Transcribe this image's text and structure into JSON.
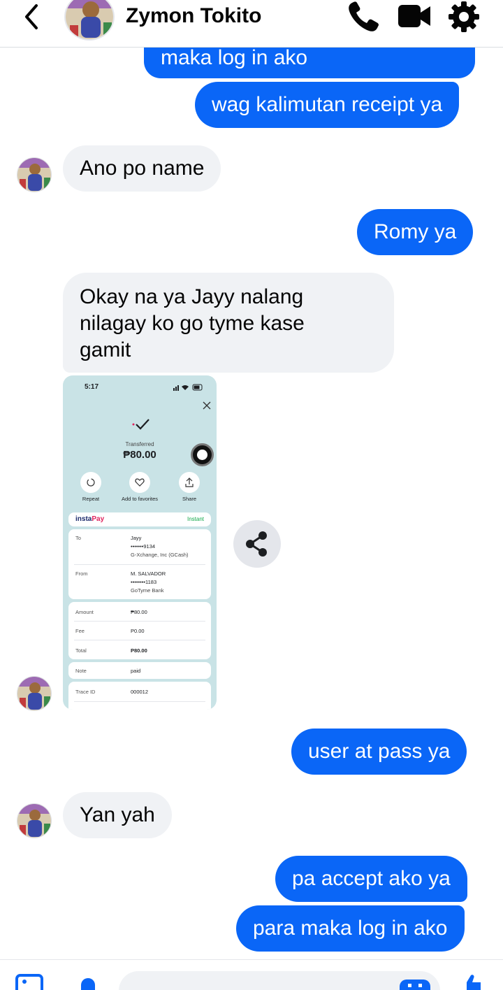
{
  "header": {
    "contact_name": "Zymon Tokito",
    "icons": [
      "back-arrow-icon",
      "phone-icon",
      "video-camera-icon",
      "gear-icon"
    ]
  },
  "messages": [
    {
      "side": "out",
      "text": "maka log in ako"
    },
    {
      "side": "out",
      "text": "wag kalimutan receipt ya"
    },
    {
      "side": "in",
      "text": "Ano po name"
    },
    {
      "side": "out",
      "text": "Romy ya"
    },
    {
      "side": "in",
      "lines": [
        "Okay na ya Jayy nalang",
        "nilagay ko go tyme kase",
        "gamit"
      ]
    },
    {
      "side": "out",
      "text": "user at pass ya"
    },
    {
      "side": "in",
      "text": "Yan yah"
    },
    {
      "side": "out",
      "text": "pa accept ako ya"
    },
    {
      "side": "out",
      "text": "para maka log in ako"
    }
  ],
  "receipt": {
    "time": "5:17",
    "battery": "6",
    "status": "Transferred",
    "amount": "₱80.00",
    "actions": [
      "Repeat",
      "Add to favorites",
      "Share"
    ],
    "brand_prefix": "insta",
    "brand_suffix": "Pay",
    "mode": "Instant",
    "to_label": "To",
    "to_name": "Jayy",
    "to_account": "•••••••9134",
    "to_bank": "G-Xchange, Inc (GCash)",
    "from_label": "From",
    "from_name": "M. SALVADOR",
    "from_account": "••••••••1183",
    "from_bank": "GoTyme Bank",
    "amount_label": "Amount",
    "amount_value": "₱80.00",
    "fee_label": "Fee",
    "fee_value": "P0.00",
    "total_label": "Total",
    "total_value": "P80.00",
    "note_label": "Note",
    "note_value": "paid",
    "trace_label": "Trace ID",
    "trace_value": "000012"
  },
  "composer": {
    "placeholder": "",
    "icons": [
      "image-icon",
      "microphone-icon",
      "emoji-icon",
      "like-icon"
    ]
  },
  "colors": {
    "outgoing_bubble": "#0a66f7",
    "incoming_bubble": "#f0f2f5",
    "receipt_background": "#c9e3e6",
    "instapay_red": "#e0245e",
    "instant_green": "#12a84a"
  }
}
